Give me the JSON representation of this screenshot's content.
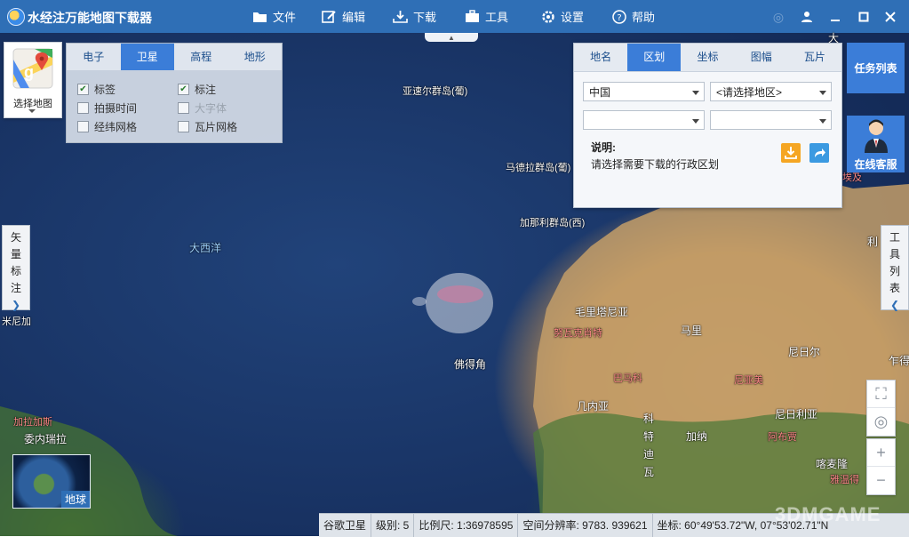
{
  "window": {
    "title": "水经注万能地图下载器",
    "menu": [
      {
        "label": "文件",
        "icon": "folder-icon"
      },
      {
        "label": "编辑",
        "icon": "edit-icon"
      },
      {
        "label": "下载",
        "icon": "download-icon"
      },
      {
        "label": "工具",
        "icon": "toolbox-icon"
      },
      {
        "label": "设置",
        "icon": "gear-icon"
      },
      {
        "label": "帮助",
        "icon": "help-icon"
      }
    ],
    "controls": [
      "user-icon",
      "minimize-icon",
      "maximize-icon",
      "close-icon"
    ]
  },
  "map_chooser": {
    "label": "选择地图"
  },
  "layer_panel": {
    "tabs": [
      "电子",
      "卫星",
      "高程",
      "地形"
    ],
    "active_tab": "卫星",
    "options": [
      {
        "label": "标签",
        "checked": true,
        "disabled": false
      },
      {
        "label": "标注",
        "checked": true,
        "disabled": false
      },
      {
        "label": "拍摄时间",
        "checked": false,
        "disabled": false
      },
      {
        "label": "大字体",
        "checked": false,
        "disabled": true
      },
      {
        "label": "经纬网格",
        "checked": false,
        "disabled": false
      },
      {
        "label": "瓦片网格",
        "checked": false,
        "disabled": false
      }
    ]
  },
  "region_panel": {
    "tabs": [
      "地名",
      "区划",
      "坐标",
      "图幅",
      "瓦片"
    ],
    "active_tab": "区划",
    "country_select": "中国",
    "region_select": "<请选择地区>",
    "city_select": "",
    "county_select": "",
    "desc_title": "说明:",
    "desc_text": "请选择需要下载的行政区划"
  },
  "right_buttons": {
    "task_list": "任务列表",
    "online_service": "在线客服",
    "tool_list": [
      "工",
      "具",
      "列",
      "表"
    ]
  },
  "left_tab": {
    "chars": [
      "矢",
      "量",
      "标",
      "注"
    ]
  },
  "globe": {
    "label": "地球"
  },
  "map_labels": {
    "atlantic": "大西洋",
    "azores": "亚速尔群岛(葡)",
    "madeira": "马德拉群岛(葡)",
    "canary": "加那利群岛(西)",
    "mauritania": "毛里塔尼亚",
    "nouakchott": "努瓦克肖特",
    "mali": "马里",
    "niger": "尼日尔",
    "chad_partial": "乍得",
    "cape_verde": "佛得角",
    "bamako": "巴马科",
    "niamey": "尼亚美",
    "guinea": "几内亚",
    "nigeria": "尼日利亚",
    "ghana": "加纳",
    "abuja": "阿布贾",
    "cameroon": "喀麦隆",
    "yaounde": "雅温得",
    "ivory_coast_chars": [
      "科",
      "特",
      "迪",
      "瓦"
    ],
    "caracas": "加拉加斯",
    "venezuela": "委内瑞拉",
    "jamaica_partial": "米尼加",
    "top_right": "大",
    "libya_partial": "利",
    "egypt_partial": "埃及"
  },
  "status_bar": {
    "source": "谷歌卫星",
    "level": "级别:  5",
    "scale": "比例尺:  1:36978595",
    "resolution": "空间分辨率:  9783. 939621",
    "coords": "坐标:   60°49'53.72\"W, 07°53'02.71\"N"
  },
  "watermark": "3DMGAME"
}
